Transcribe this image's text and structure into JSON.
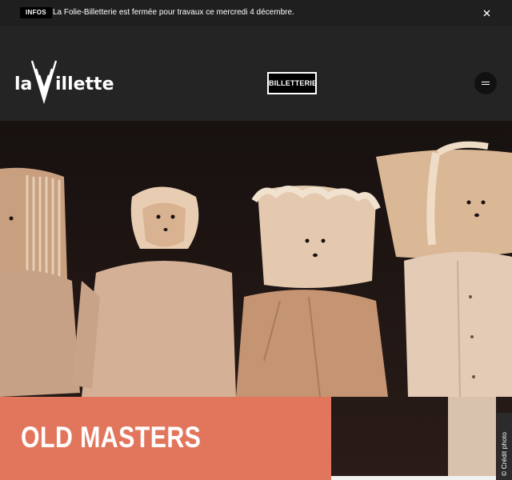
{
  "info_bar": {
    "badge": "INFOS",
    "message": "La Folie-Billetterie est fermée pour travaux ce mercredi 4 décembre."
  },
  "header": {
    "logo_text": "laVillette",
    "billetterie_label": "BILLETTERIE"
  },
  "hero": {
    "title": "OLD MASTERS",
    "credit": "© Crédit photo"
  },
  "colors": {
    "background": "#1f1f1f",
    "header": "#242424",
    "accent": "#e2765d",
    "hero_bg": "#1c1412"
  },
  "icons": [
    "close-icon",
    "menu-icon"
  ]
}
